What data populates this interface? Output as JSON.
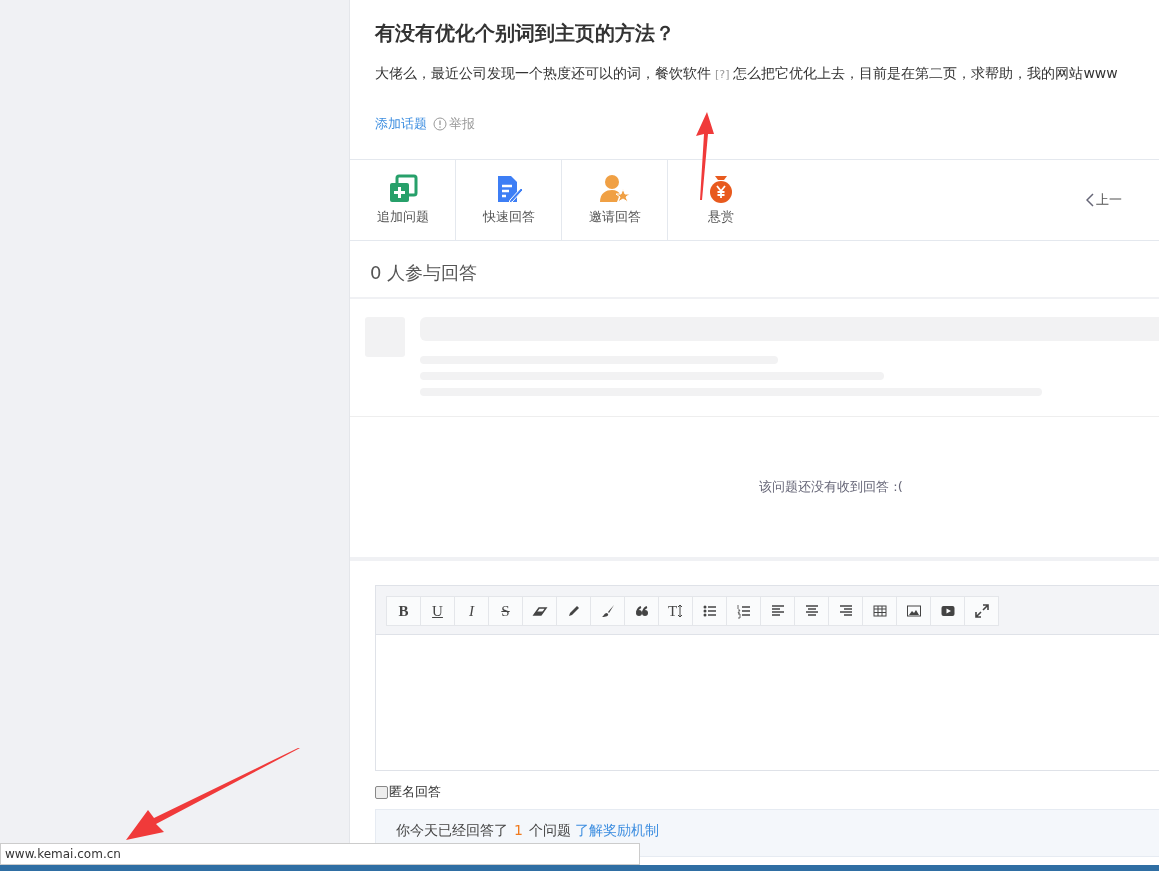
{
  "question": {
    "title": "有没有优化个别词到主页的方法？",
    "body_start": "大佬么，最近公司发现一个热度还可以的词，餐饮软件",
    "body_mark": "[?]",
    "body_end": "怎么把它优化上去，目前是在第二页，求帮助，我的网站www",
    "add_topic": "添加话题",
    "report": "举报"
  },
  "actions": [
    {
      "kind": "add",
      "label": "追加问题"
    },
    {
      "kind": "quick",
      "label": "快速回答"
    },
    {
      "kind": "invite",
      "label": "邀请回答"
    },
    {
      "kind": "bounty",
      "label": "悬赏"
    }
  ],
  "prev": "上一",
  "answers": {
    "count": "0",
    "label": "人参与回答",
    "empty": "该问题还没有收到回答 :("
  },
  "toolbar": [
    {
      "kind": "bold",
      "label": "B"
    },
    {
      "kind": "underline",
      "label": "U"
    },
    {
      "kind": "italic",
      "label": "I"
    },
    {
      "kind": "strike",
      "label": "S"
    },
    {
      "kind": "eraser"
    },
    {
      "kind": "pencil"
    },
    {
      "kind": "brush"
    },
    {
      "kind": "quote"
    },
    {
      "kind": "textsize",
      "label": "T"
    },
    {
      "kind": "bullets"
    },
    {
      "kind": "numbers"
    },
    {
      "kind": "left"
    },
    {
      "kind": "center"
    },
    {
      "kind": "right"
    },
    {
      "kind": "table"
    },
    {
      "kind": "image"
    },
    {
      "kind": "video"
    },
    {
      "kind": "fullscreen"
    }
  ],
  "anonymous": {
    "label": "匿名回答",
    "checked": false
  },
  "notice": {
    "before": "你今天已经回答了",
    "count": "1",
    "after": "个问题",
    "link": "了解奖励机制"
  },
  "status_url": "www.kemai.com.cn"
}
